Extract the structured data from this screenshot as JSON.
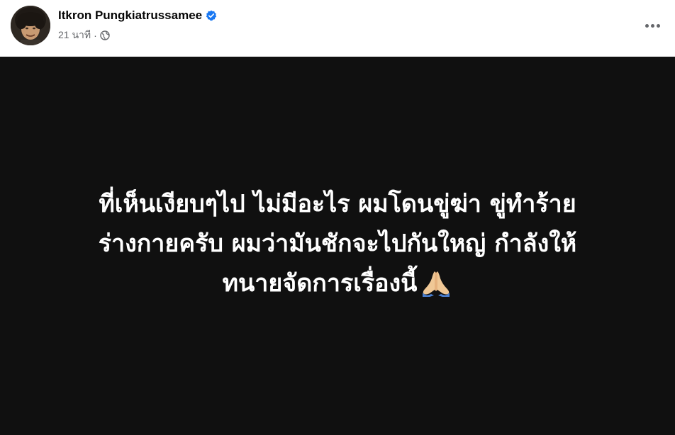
{
  "post": {
    "author_name": "Itkron Pungkiatrussamee",
    "verified": true,
    "time": "21 นาที",
    "separator": "·",
    "privacy_icon": "globe-icon",
    "more_icon": "more-options-icon"
  },
  "content": {
    "background": "#101010",
    "text_color": "#ffffff",
    "lines": [
      "ที่เห็นเงียบๆไป ไม่มีอะไร ผมโดนขู่ฆ่า ขู่ทำร้าย",
      "ร่างกายครับ ผมว่ามันชักจะไปกันใหญ่ กำลังให้",
      "ทนายจัดการเรื่องนี้"
    ],
    "emoji": "folded-hands-icon"
  },
  "colors": {
    "verified_badge": "#1877f2",
    "secondary_text": "#65676b",
    "primary_text": "#050505"
  }
}
